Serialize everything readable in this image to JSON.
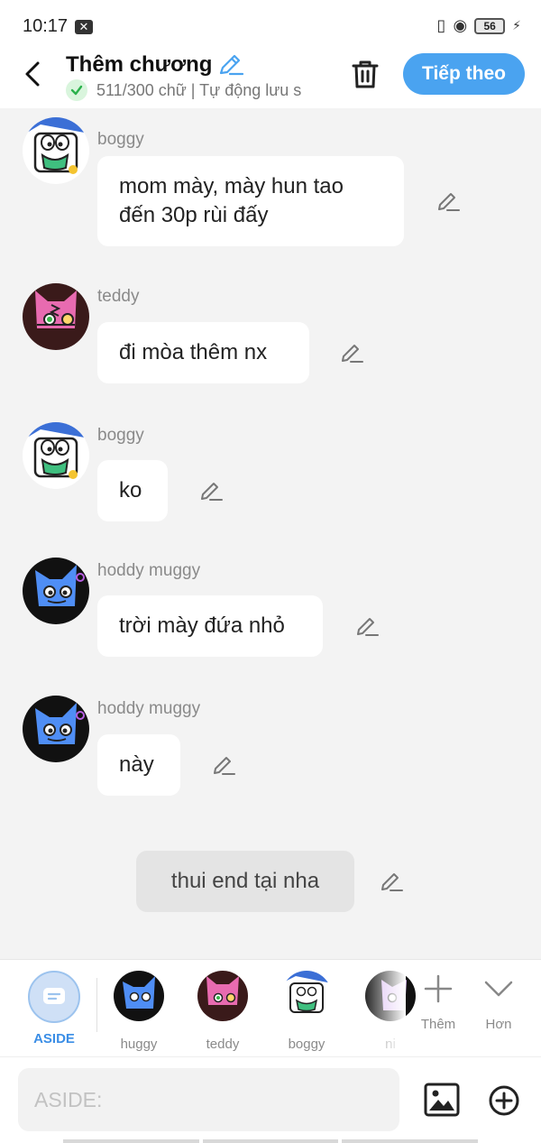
{
  "status": {
    "time": "10:17",
    "battery": "56"
  },
  "header": {
    "title": "Thêm chương",
    "subtitle": "511/300 chữ | Tự động lưu s",
    "next_label": "Tiếp theo"
  },
  "messages": [
    {
      "sender": "boggy",
      "text": "mom mày, mày hun tao đến 30p rùi đấy"
    },
    {
      "sender": "teddy",
      "text": "đi mòa thêm nx"
    },
    {
      "sender": "boggy",
      "text": "ko"
    },
    {
      "sender": "hoddy muggy",
      "text": "trời mày đứa nhỏ"
    },
    {
      "sender": "hoddy muggy",
      "text": "này"
    }
  ],
  "aside_message": {
    "text": "thui end tại  nha"
  },
  "characters": [
    {
      "label": "ASIDE"
    },
    {
      "label": "huggy"
    },
    {
      "label": "teddy"
    },
    {
      "label": "boggy"
    },
    {
      "label": "ni"
    }
  ],
  "tools": {
    "more_label": "Thêm",
    "collapse_label": "Hơn"
  },
  "input": {
    "placeholder": "ASIDE:"
  },
  "colors": {
    "accent": "#4aa3f0",
    "aside_label": "#3b8ee6",
    "bubble": "#ffffff",
    "background": "#f3f3f3"
  },
  "icons": [
    "back-arrow-icon",
    "pencil-icon",
    "check-icon",
    "trash-icon",
    "edit-pencil-icon",
    "plus-icon",
    "chevron-down-icon",
    "image-icon",
    "add-circle-icon",
    "aside-chat-icon"
  ]
}
